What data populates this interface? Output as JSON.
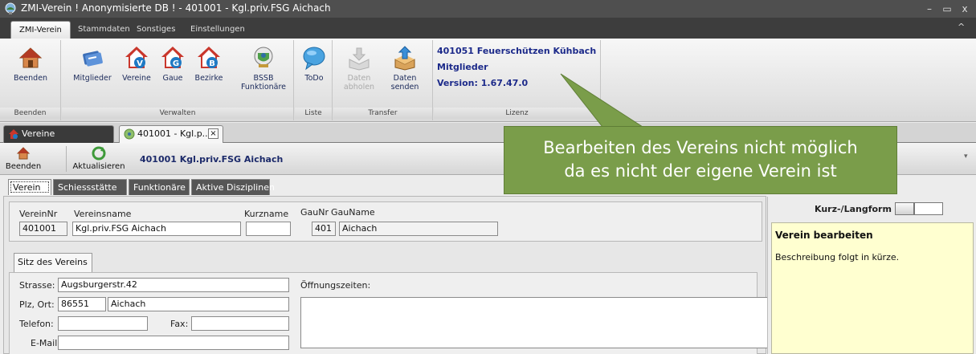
{
  "window": {
    "title": "ZMI-Verein ! Anonymisierte DB !  - 401001 - Kgl.priv.FSG Aichach",
    "controls": [
      "–",
      "▭",
      "x"
    ]
  },
  "ribbon_tabs": [
    "ZMI-Verein",
    "Stammdaten",
    "Sonstiges",
    "Einstellungen"
  ],
  "ribbon_collapse": "^",
  "ribbon": {
    "groups": {
      "beenden": "Beenden",
      "verwalten": "Verwalten",
      "liste": "Liste",
      "transfer": "Transfer",
      "lizenz": "Lizenz"
    },
    "buttons": {
      "beenden": "Beenden",
      "mitglieder": "Mitglieder",
      "vereine": "Vereine",
      "gaue": "Gaue",
      "bezirke": "Bezirke",
      "bssb_1": "BSSB",
      "bssb_2": "Funktionäre",
      "todo": "ToDo",
      "daten_abholen_1": "Daten",
      "daten_abholen_2": "abholen",
      "daten_senden_1": "Daten",
      "daten_senden_2": "senden"
    },
    "license": {
      "line1": "401051 Feuerschützen Kühbach",
      "line2": "Mitglieder",
      "line3": "Version: 1.67.47.0"
    }
  },
  "doc_tabs": {
    "vereine": "Vereine",
    "active": "401001 - Kgl.p...",
    "close": "×"
  },
  "toolbar": {
    "beenden": "Beenden",
    "aktualisieren": "Aktualisieren",
    "title": "401001  Kgl.priv.FSG Aichach",
    "dropdown": "▾"
  },
  "sub_tabs": [
    "Verein",
    "Schiessstätte",
    "Funktionäre",
    "Aktive Disziplinen"
  ],
  "verein": {
    "vereinnr_label": "VereinNr",
    "vereinnr": "401001",
    "vereinsname_label": "Vereinsname",
    "vereinsname": "Kgl.priv.FSG Aichach",
    "kurzname_label": "Kurzname",
    "kurzname": "",
    "gaunr_label": "GauNr",
    "gaunr": "401",
    "gauname_label": "GauName",
    "gauname": "Aichach"
  },
  "sitz": {
    "tab": "Sitz des Vereins",
    "strasse_label": "Strasse:",
    "strasse": "Augsburgerstr.42",
    "plz_label": "Plz, Ort:",
    "plz": "86551",
    "ort": "Aichach",
    "telefon_label": "Telefon:",
    "telefon": "",
    "fax_label": "Fax:",
    "fax": "",
    "email_label": "E-Mail",
    "email": "",
    "oeffnungszeiten_label": "Öffnungszeiten:"
  },
  "right_panel": {
    "toggle_label": "Kurz-/Langform",
    "help_title": "Verein bearbeiten",
    "help_text": "Beschreibung folgt in kürze."
  },
  "callout": {
    "line1": "Bearbeiten des Vereins nicht möglich",
    "line2": "da es nicht der eigene Verein ist"
  },
  "colors": {
    "titlebar": "#4f4f4f",
    "ribbon_text": "#1b2a5a",
    "license_text": "#1c2a8a",
    "callout": "#7a9d4a",
    "help_bg": "#ffffd0"
  }
}
